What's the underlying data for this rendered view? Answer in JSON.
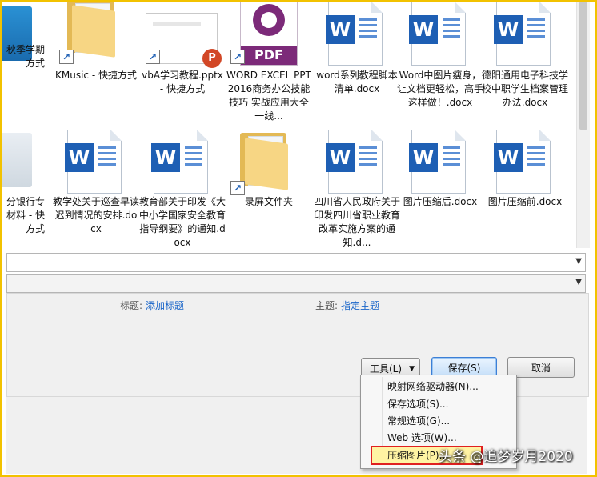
{
  "files_row1": [
    {
      "name": "秋季学期\n方式",
      "icon": "app-icon"
    },
    {
      "name": "KMusic - 快捷方式",
      "icon": "folder-shortcut-icon"
    },
    {
      "name": "vbA学习教程.pptx - 快捷方式",
      "icon": "pptx-shortcut-icon"
    },
    {
      "name": "WORD EXCEL PPT2016商务办公技能 技巧 实战应用大全 一线...",
      "icon": "pdf-icon"
    },
    {
      "name": "word系列教程脚本清单.docx",
      "icon": "word-doc-icon"
    },
    {
      "name": "Word中图片瘦身，让文档更轻松，高手这样做！.docx",
      "icon": "word-doc-icon"
    },
    {
      "name": "德阳通用电子科技学校中职学生档案管理办法.docx",
      "icon": "word-doc-icon"
    }
  ],
  "files_row2": [
    {
      "name": "分银行专\n材料 - 快\n方式",
      "icon": "app-icon"
    },
    {
      "name": "教学处关于巡查早读迟到情况的安排.docx",
      "icon": "word-doc-icon"
    },
    {
      "name": "教育部关于印发《大中小学国家安全教育指导纲要》的通知.docx",
      "icon": "word-doc-icon"
    },
    {
      "name": "录屏文件夹",
      "icon": "folder-shortcut-icon"
    },
    {
      "name": "四川省人民政府关于印发四川省职业教育改革实施方案的通知.d...",
      "icon": "word-doc-icon"
    },
    {
      "name": "图片压缩后.docx",
      "icon": "word-doc-icon"
    },
    {
      "name": "图片压缩前.docx",
      "icon": "word-doc-icon"
    }
  ],
  "meta": {
    "title_label": "标题:",
    "title_value": "添加标题",
    "subject_label": "主题:",
    "subject_value": "指定主题"
  },
  "buttons": {
    "tools": "工具(L)",
    "save": "保存(S)",
    "cancel": "取消"
  },
  "tools_menu": [
    "映射网络驱动器(N)...",
    "保存选项(S)...",
    "常规选项(G)...",
    "Web 选项(W)...",
    "压缩图片(P)..."
  ],
  "watermark": "头条 @追梦岁月2020",
  "colors": {
    "accent": "#1a66c9",
    "highlight_border": "#e02020",
    "highlight_fill": "#fff3a3",
    "frame": "#f2c200"
  }
}
